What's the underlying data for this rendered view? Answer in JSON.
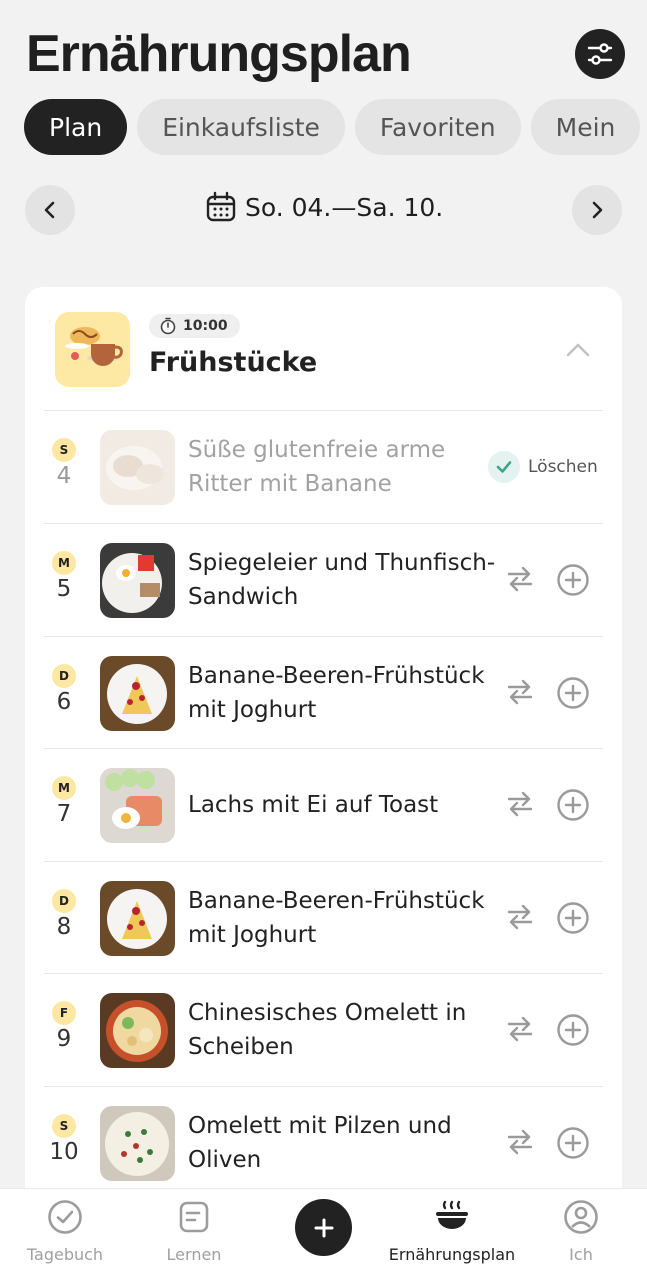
{
  "header": {
    "title": "Ernährungsplan",
    "tabs": [
      {
        "label": "Plan",
        "active": true
      },
      {
        "label": "Einkaufsliste"
      },
      {
        "label": "Favoriten"
      },
      {
        "label": "Mein"
      }
    ]
  },
  "date_nav": {
    "range": "So. 04.—Sa. 10."
  },
  "meal": {
    "time": "10:00",
    "title": "Frühstücke",
    "rows": [
      {
        "day_letter": "S",
        "day_num": "4",
        "recipe": "Süße glutenfreie arme Ritter mit Banane",
        "status": "Löschen",
        "done": true
      },
      {
        "day_letter": "M",
        "day_num": "5",
        "recipe": "Spiegeleier und Thunfisch-Sandwich"
      },
      {
        "day_letter": "D",
        "day_num": "6",
        "recipe": "Banane-Beeren-Frühstück mit Joghurt"
      },
      {
        "day_letter": "M",
        "day_num": "7",
        "recipe": "Lachs mit Ei auf Toast"
      },
      {
        "day_letter": "D",
        "day_num": "8",
        "recipe": "Banane-Beeren-Frühstück mit Joghurt"
      },
      {
        "day_letter": "F",
        "day_num": "9",
        "recipe": "Chinesisches Omelett in Scheiben"
      },
      {
        "day_letter": "S",
        "day_num": "10",
        "recipe": "Omelett mit Pilzen und Oliven"
      }
    ]
  },
  "bottom_nav": [
    {
      "label": "Tagebuch",
      "icon": "check-circle-icon"
    },
    {
      "label": "Lernen",
      "icon": "note-icon"
    },
    {
      "label": "Ernährungsplan",
      "icon": "bowl-icon",
      "active": true
    },
    {
      "label": "Ich",
      "icon": "profile-icon"
    }
  ],
  "colors": {
    "accent_dark": "#222222",
    "day_badge": "#fde7a2",
    "check_green": "#3aa68c"
  }
}
